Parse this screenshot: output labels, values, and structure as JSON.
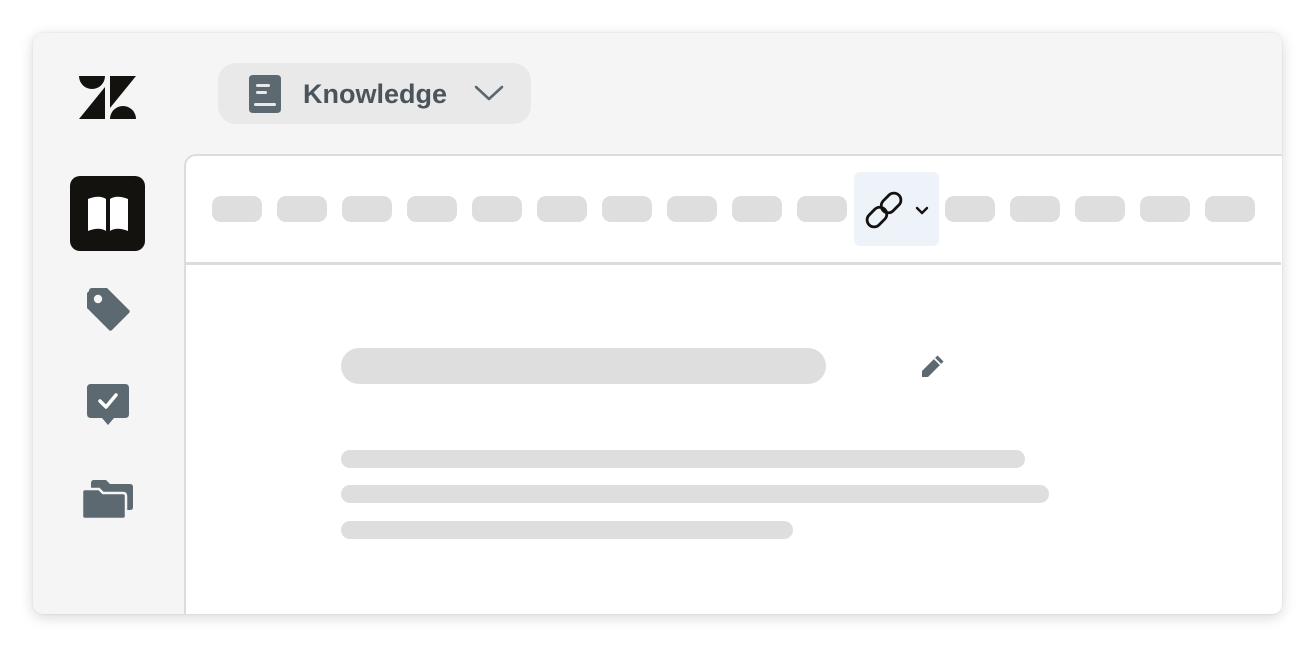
{
  "product_switcher": {
    "label": "Knowledge",
    "icon": "book-icon",
    "dropdown_icon": "chevron-down-icon"
  },
  "sidebar": {
    "logo": "zendesk-logo",
    "items": [
      {
        "name": "knowledge",
        "icon": "open-book-icon",
        "active": true
      },
      {
        "name": "labels",
        "icon": "tag-icon",
        "active": false
      },
      {
        "name": "approvals",
        "icon": "checkmark-chat-icon",
        "active": false
      },
      {
        "name": "content-management",
        "icon": "folders-icon",
        "active": false
      }
    ]
  },
  "toolbar": {
    "placeholder_buttons_before_link": 10,
    "link_button": {
      "icon": "link-icon",
      "dropdown_icon": "chevron-down-icon",
      "highlighted": true
    },
    "placeholder_buttons_after_link": 5
  },
  "article": {
    "title": "",
    "edit_icon": "pencil-icon",
    "body_lines": [
      "",
      "",
      ""
    ]
  },
  "colors": {
    "window_bg": "#f5f5f5",
    "active_nav_bg": "#14120f",
    "icon_gray": "#5c6970",
    "switcher_text": "#49545c",
    "placeholder": "#dedede",
    "link_button_bg": "#edf3f8"
  }
}
